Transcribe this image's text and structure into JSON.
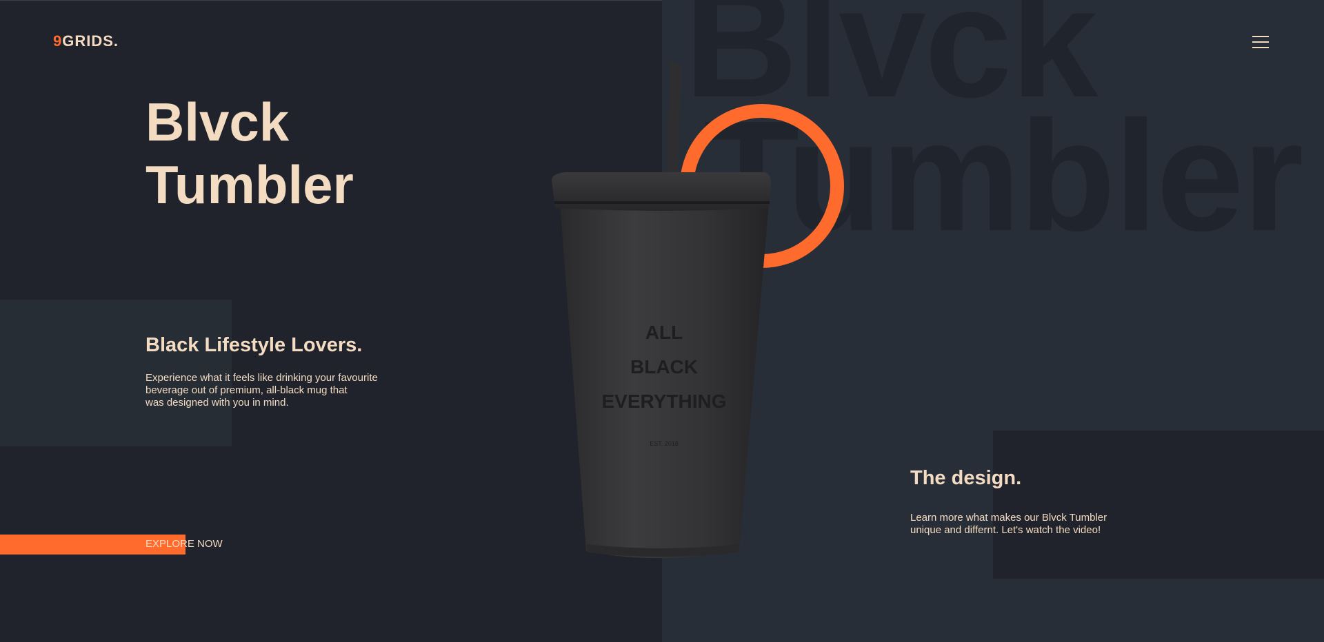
{
  "brand": {
    "logo_number": "9",
    "logo_text": "GRIDS.",
    "accent_color": "#ff6a2d",
    "text_color": "#f3dcc2"
  },
  "nav": {
    "menu_icon": "hamburger-menu-icon"
  },
  "background": {
    "word_line_1": "Blvck",
    "word_line_2": "Tumbler"
  },
  "hero": {
    "title_line_1": "Blvck",
    "title_line_2": "Tumbler"
  },
  "intro": {
    "subtitle": "Black Lifestyle Lovers.",
    "description_lines": [
      "Experience what it feels like drinking your favourite",
      "beverage out of premium, all-black mug that",
      "was designed with you in mind."
    ]
  },
  "cta": {
    "label": "EXPLORE NOW"
  },
  "design": {
    "title": "The design.",
    "description_lines": [
      "Learn more what makes our Blvck Tumbler",
      "unique and differnt. Let's watch the video!"
    ]
  },
  "product": {
    "print_lines": [
      "ALL",
      "BLACK",
      "EVERYTHING"
    ],
    "est_text": "EST. 2018"
  }
}
